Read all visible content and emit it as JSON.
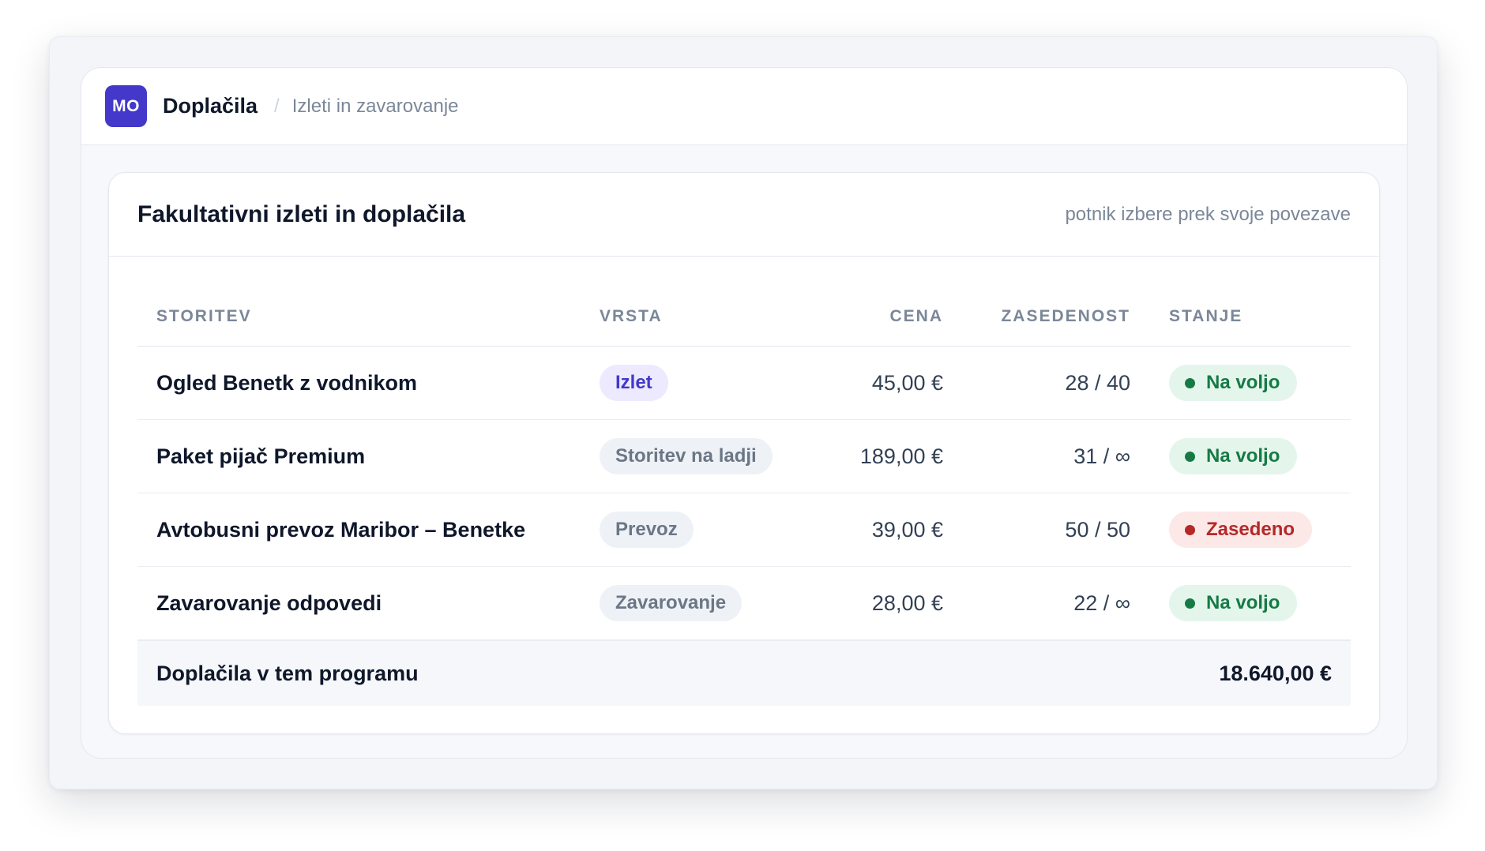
{
  "header": {
    "avatar": "MO",
    "title": "Doplačila",
    "separator": "/",
    "breadcrumb": "Izleti in zavarovanje"
  },
  "card": {
    "title": "Fakultativni izleti in doplačila",
    "hint": "potnik izbere prek svoje povezave"
  },
  "table": {
    "columns": [
      "STORITEV",
      "VRSTA",
      "CENA",
      "ZASEDENOST",
      "STANJE"
    ],
    "rows": [
      {
        "name": "Ogled Benetk z vodnikom",
        "type": "Izlet",
        "price": "45,00 €",
        "occupancy": "28 / 40",
        "status": "Na voljo"
      },
      {
        "name": "Paket pijač Premium",
        "type": "Storitev na ladji",
        "price": "189,00 €",
        "occupancy": "31 / ∞",
        "status": "Na voljo"
      },
      {
        "name": "Avtobusni prevoz Maribor – Benetke",
        "type": "Prevoz",
        "price": "39,00 €",
        "occupancy": "50 / 50",
        "status": "Zasedeno"
      },
      {
        "name": "Zavarovanje odpovedi",
        "type": "Zavarovanje",
        "price": "28,00 €",
        "occupancy": "22 / ∞",
        "status": "Na voljo"
      }
    ],
    "total_label": "Doplačila v tem programu",
    "total_value": "18.640,00 €"
  },
  "colors": {
    "accent": "#4338ca",
    "available": "#167a45",
    "full": "#b42828"
  }
}
